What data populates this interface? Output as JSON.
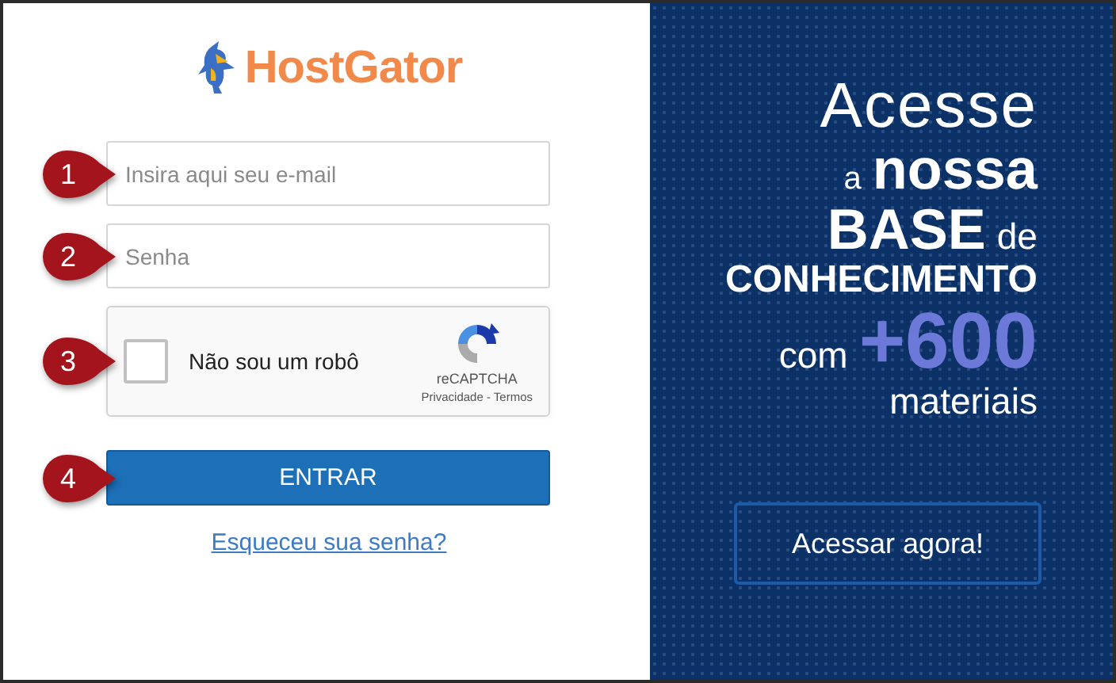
{
  "logo": {
    "text": "HostGator"
  },
  "form": {
    "email": {
      "placeholder": "Insira aqui seu e-mail",
      "marker": "1"
    },
    "password": {
      "placeholder": "Senha",
      "marker": "2"
    },
    "captcha": {
      "marker": "3",
      "checked": false,
      "label": "Não sou um robô",
      "brand": "reCAPTCHA",
      "links": "Privacidade - Termos"
    },
    "submit": {
      "label": "ENTRAR",
      "marker": "4"
    },
    "forgot_link": "Esqueceu sua senha?"
  },
  "banner": {
    "lines": [
      [
        {
          "kind": "light",
          "text": "Acesse"
        }
      ],
      [
        {
          "kind": "small",
          "text": "a"
        },
        {
          "kind": "bold",
          "text": "nossa"
        }
      ],
      [
        {
          "kind": "bold",
          "text": "BASE"
        },
        {
          "kind": "regular",
          "text": "de"
        }
      ],
      [
        {
          "kind": "caps",
          "text": "CONHECIMENTO"
        }
      ],
      [
        {
          "kind": "regular",
          "text": "com"
        },
        {
          "kind": "accent",
          "text": "+600"
        }
      ],
      [
        {
          "kind": "regular",
          "text": "materiais"
        }
      ]
    ],
    "button": "Acessar agora!"
  }
}
